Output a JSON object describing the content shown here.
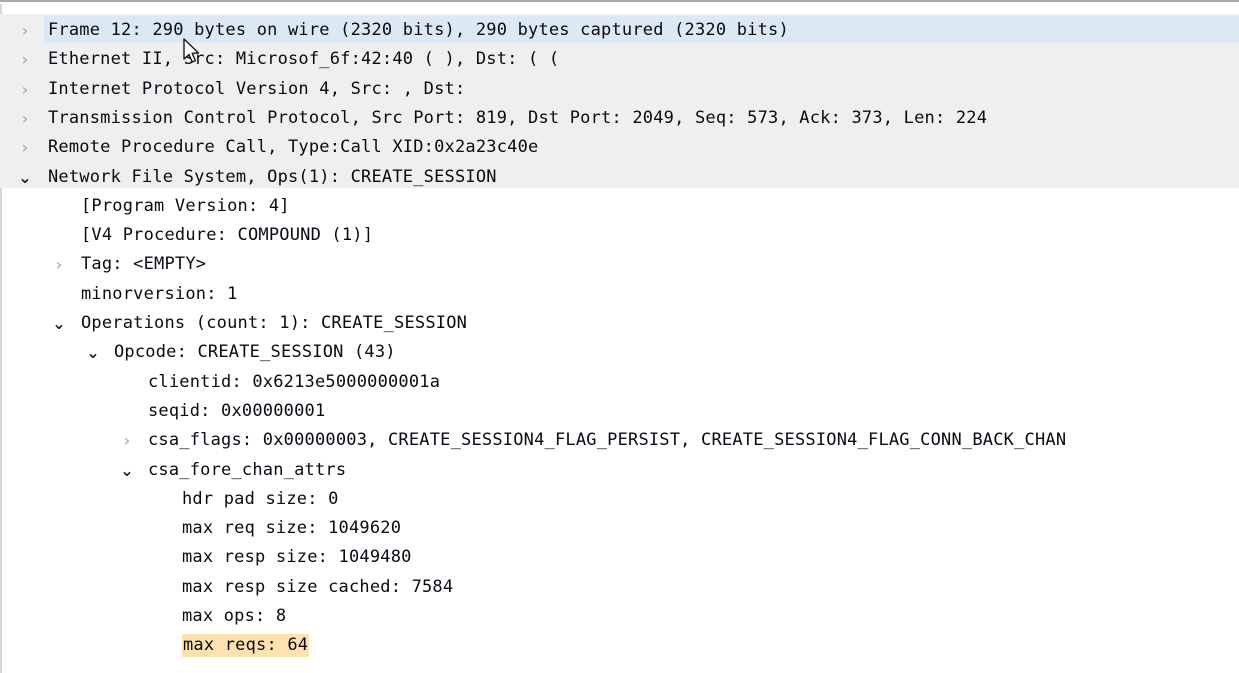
{
  "app": {
    "name": "wireshark-packet-details",
    "pane_title": "Packet details tree"
  },
  "colors": {
    "selection": "#dce8f4",
    "root_band": "#efefef",
    "find_highlight": "#ffe2ae",
    "text": "#0a0a14",
    "twisty_collapsed": "#b4b4b4",
    "twisty_expanded": "#1c1c1c",
    "background": "#ffffff"
  },
  "icons": {
    "collapsed": "›",
    "expanded": "⌄"
  },
  "tree": [
    {
      "id": "frame",
      "state": "collapsed",
      "depth": 0,
      "selected": true,
      "text": "Frame 12: 290 bytes on wire (2320 bits), 290 bytes captured (2320 bits)"
    },
    {
      "id": "ethernet",
      "state": "collapsed",
      "depth": 0,
      "selected": false,
      "text": "Ethernet II, Src: Microsof_6f:42:40 (                  ), Dst:                          (                                      ("
    },
    {
      "id": "ipv4",
      "state": "collapsed",
      "depth": 0,
      "selected": false,
      "text": "Internet Protocol Version 4, Src:             , Dst:"
    },
    {
      "id": "tcp",
      "state": "collapsed",
      "depth": 0,
      "selected": false,
      "text": "Transmission Control Protocol, Src Port: 819, Dst Port: 2049, Seq: 573, Ack: 373, Len: 224"
    },
    {
      "id": "rpc",
      "state": "collapsed",
      "depth": 0,
      "selected": false,
      "text": "Remote Procedure Call, Type:Call XID:0x2a23c40e"
    },
    {
      "id": "nfs",
      "state": "expanded",
      "depth": 0,
      "selected": false,
      "text": "Network File System, Ops(1): CREATE_SESSION"
    },
    {
      "id": "program-version",
      "state": "leaf",
      "depth": 1,
      "selected": false,
      "text": "[Program Version: 4]"
    },
    {
      "id": "v4-procedure",
      "state": "leaf",
      "depth": 1,
      "selected": false,
      "text": "[V4 Procedure: COMPOUND (1)]"
    },
    {
      "id": "tag",
      "state": "collapsed",
      "depth": 1,
      "selected": false,
      "text": "Tag: <EMPTY>"
    },
    {
      "id": "minorversion",
      "state": "leaf",
      "depth": 1,
      "selected": false,
      "text": "minorversion: 1"
    },
    {
      "id": "operations",
      "state": "expanded",
      "depth": 1,
      "selected": false,
      "text": "Operations (count: 1): CREATE_SESSION"
    },
    {
      "id": "opcode",
      "state": "expanded",
      "depth": 2,
      "selected": false,
      "text": "Opcode: CREATE_SESSION (43)"
    },
    {
      "id": "clientid",
      "state": "leaf",
      "depth": 3,
      "selected": false,
      "text": "clientid: 0x6213e5000000001a"
    },
    {
      "id": "seqid",
      "state": "leaf",
      "depth": 3,
      "selected": false,
      "text": "seqid: 0x00000001"
    },
    {
      "id": "csa-flags",
      "state": "collapsed",
      "depth": 3,
      "selected": false,
      "text": "csa_flags: 0x00000003, CREATE_SESSION4_FLAG_PERSIST, CREATE_SESSION4_FLAG_CONN_BACK_CHAN"
    },
    {
      "id": "csa-fore-chan-attrs",
      "state": "expanded",
      "depth": 3,
      "selected": false,
      "text": "csa_fore_chan_attrs"
    },
    {
      "id": "hdr-pad-size",
      "state": "leaf",
      "depth": 4,
      "selected": false,
      "text": "hdr pad size: 0"
    },
    {
      "id": "max-req-size",
      "state": "leaf",
      "depth": 4,
      "selected": false,
      "text": "max req size: 1049620"
    },
    {
      "id": "max-resp-size",
      "state": "leaf",
      "depth": 4,
      "selected": false,
      "text": "max resp size: 1049480"
    },
    {
      "id": "max-resp-size-cached",
      "state": "leaf",
      "depth": 4,
      "selected": false,
      "text": "max resp size cached: 7584"
    },
    {
      "id": "max-ops",
      "state": "leaf",
      "depth": 4,
      "selected": false,
      "text": "max ops: 8"
    },
    {
      "id": "max-reqs",
      "state": "leaf",
      "depth": 4,
      "selected": false,
      "highlighted": true,
      "text": "max reqs: 64"
    }
  ]
}
